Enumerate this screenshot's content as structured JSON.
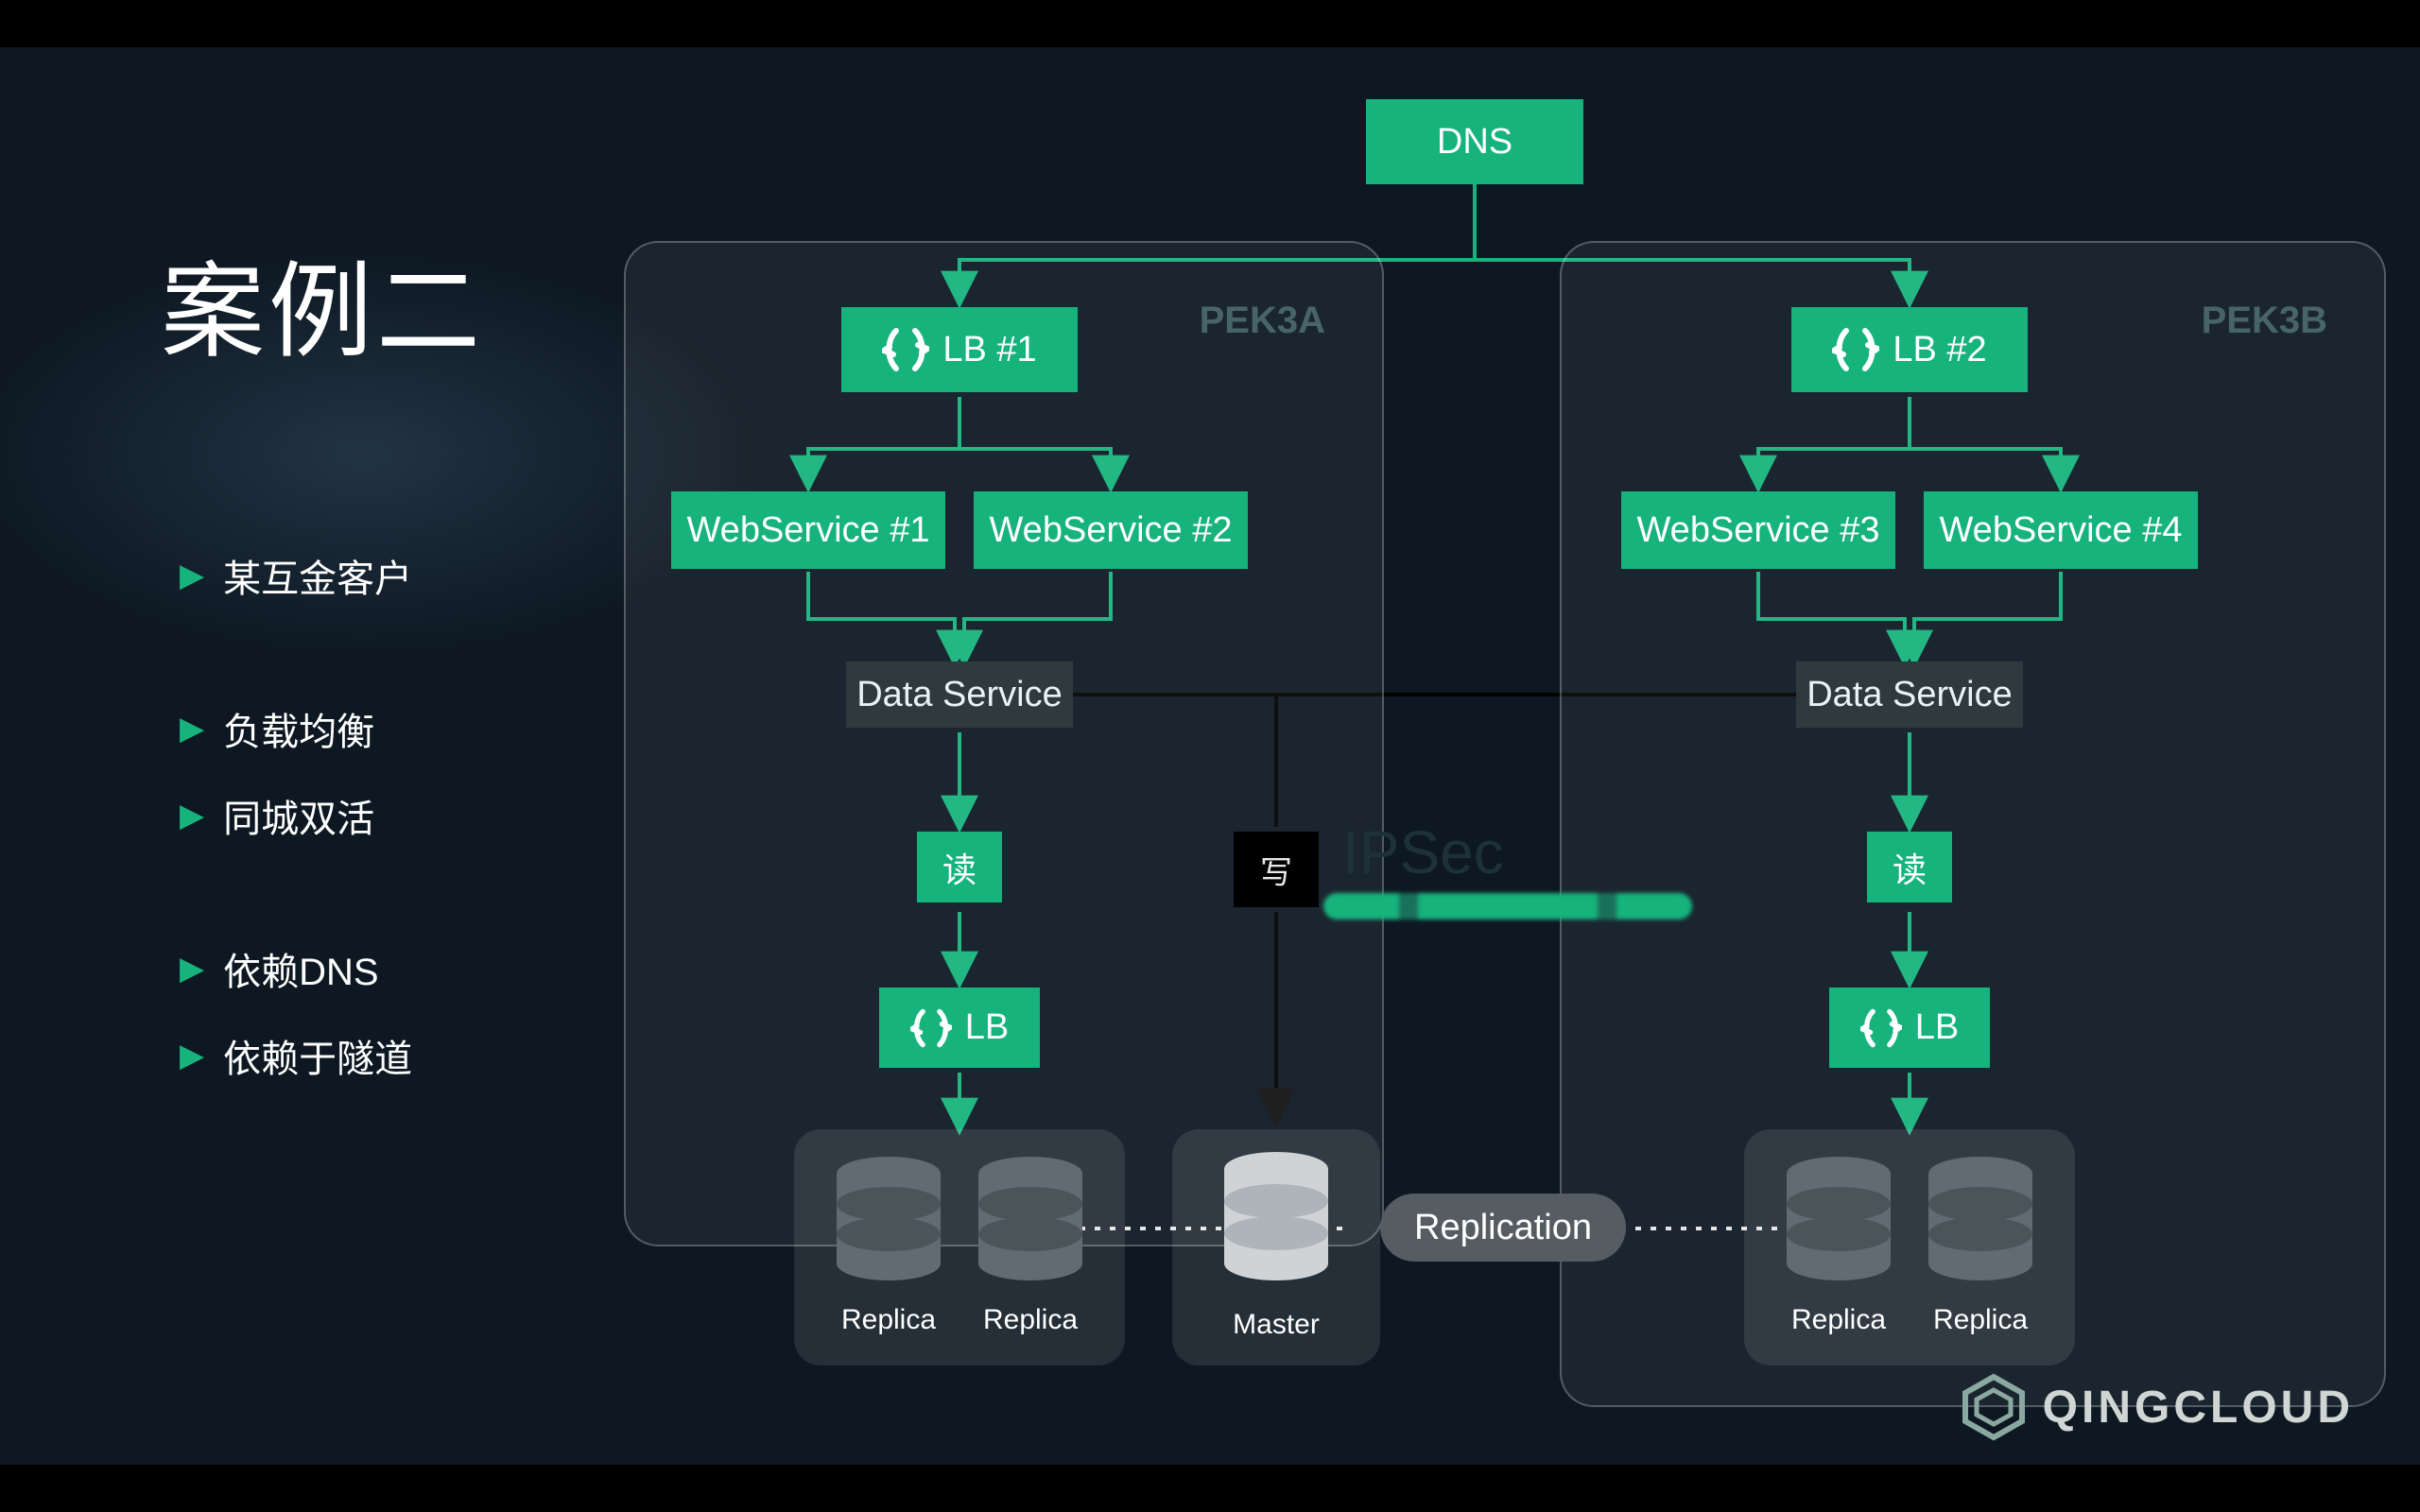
{
  "title": "案例二",
  "bullets": [
    "某互金客户",
    "负载均衡",
    "同城双活",
    "依赖DNS",
    "依赖于隧道"
  ],
  "bullet_gaps": [
    1,
    3
  ],
  "nodes": {
    "dns": "DNS",
    "lb1": "LB #1",
    "lb2": "LB #2",
    "ws1": "WebService #1",
    "ws2": "WebService #2",
    "ws3": "WebService #3",
    "ws4": "WebService #4",
    "ds": "Data Service",
    "read": "读",
    "write": "写",
    "lb": "LB",
    "replica": "Replica",
    "master": "Master",
    "replication": "Replication",
    "ipsec": "IPSec"
  },
  "regions": {
    "left": "PEK3A",
    "right": "PEK3B"
  },
  "brand": "QINGCLOUD"
}
